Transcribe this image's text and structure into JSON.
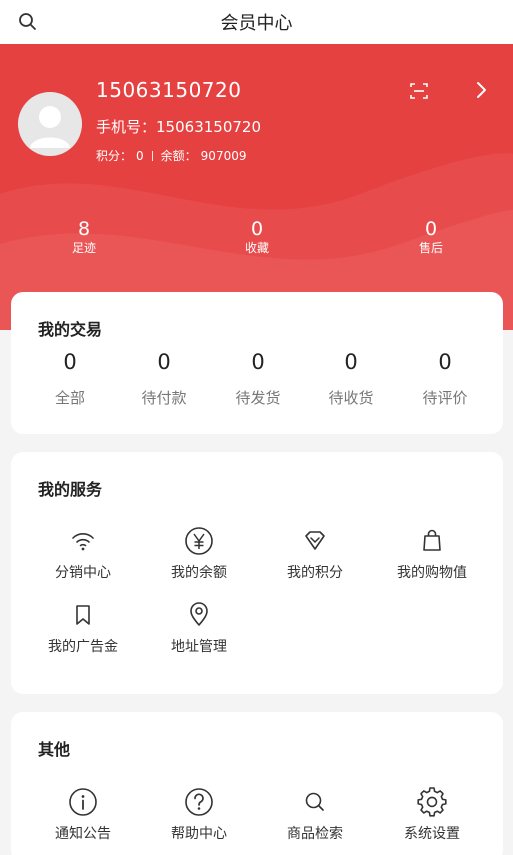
{
  "header": {
    "title": "会员中心",
    "search_icon": "search-icon"
  },
  "profile": {
    "username": "15063150720",
    "phone_label": "手机号：",
    "phone": "15063150720",
    "points_label": "积分：",
    "points": "0",
    "balance_label": "余额：",
    "balance": "907009",
    "accent_color": "#e64141"
  },
  "stats": [
    {
      "value": "8",
      "label": "足迹"
    },
    {
      "value": "0",
      "label": "收藏"
    },
    {
      "value": "0",
      "label": "售后"
    }
  ],
  "orders": {
    "title": "我的交易",
    "items": [
      {
        "value": "0",
        "label": "全部"
      },
      {
        "value": "0",
        "label": "待付款"
      },
      {
        "value": "0",
        "label": "待发货"
      },
      {
        "value": "0",
        "label": "待收货"
      },
      {
        "value": "0",
        "label": "待评价"
      }
    ]
  },
  "services": {
    "title": "我的服务",
    "items": [
      {
        "label": "分销中心",
        "icon": "wifi-icon"
      },
      {
        "label": "我的余额",
        "icon": "yen-icon"
      },
      {
        "label": "我的积分",
        "icon": "diamond-icon"
      },
      {
        "label": "我的购物值",
        "icon": "shopping-bag-icon"
      },
      {
        "label": "我的广告金",
        "icon": "bookmark-icon"
      },
      {
        "label": "地址管理",
        "icon": "location-pin-icon"
      }
    ]
  },
  "others": {
    "title": "其他",
    "items": [
      {
        "label": "通知公告",
        "icon": "info-icon"
      },
      {
        "label": "帮助中心",
        "icon": "help-icon"
      },
      {
        "label": "商品检索",
        "icon": "search-icon"
      },
      {
        "label": "系统设置",
        "icon": "gear-icon"
      }
    ]
  }
}
